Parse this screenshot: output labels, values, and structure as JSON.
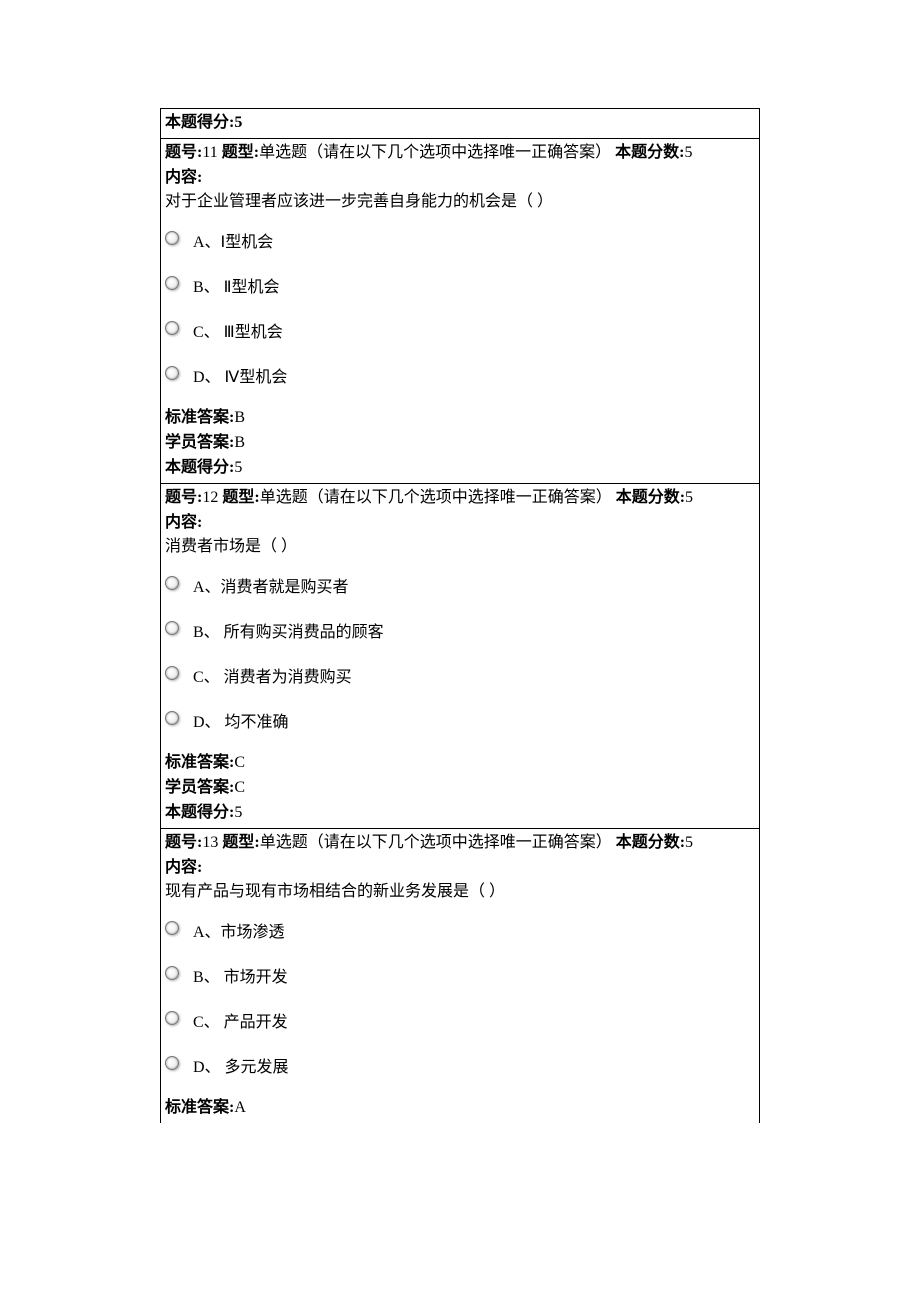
{
  "labels": {
    "question_no": "题号:",
    "question_type": "题型:",
    "question_type_value": "单选题（请在以下几个选项中选择唯一正确答案）",
    "question_score": "本题分数:",
    "content": "内容:",
    "std_answer": "标准答案:",
    "stu_answer": "学员答案:",
    "this_score": "本题得分:"
  },
  "top_score_line": "本题得分:5",
  "questions": [
    {
      "no": "11",
      "score": "5",
      "stem": "对于企业管理者应该进一步完善自身能力的机会是（  ）",
      "options": [
        "A、Ⅰ型机会",
        "B、 Ⅱ型机会",
        "C、 Ⅲ型机会",
        "D、 Ⅳ型机会"
      ],
      "std_answer": "B",
      "stu_answer": "B",
      "this_score": "5"
    },
    {
      "no": "12",
      "score": "5",
      "stem": "消费者市场是（  ）",
      "options": [
        "A、消费者就是购买者",
        "B、 所有购买消费品的顾客",
        "C、 消费者为消费购买",
        "D、 均不准确"
      ],
      "std_answer": "C",
      "stu_answer": "C",
      "this_score": "5"
    },
    {
      "no": "13",
      "score": "5",
      "stem": "现有产品与现有市场相结合的新业务发展是（  ）",
      "options": [
        "A、市场渗透",
        "B、 市场开发",
        "C、 产品开发",
        "D、 多元发展"
      ],
      "std_answer": "A",
      "stu_answer": null,
      "this_score": null
    }
  ]
}
